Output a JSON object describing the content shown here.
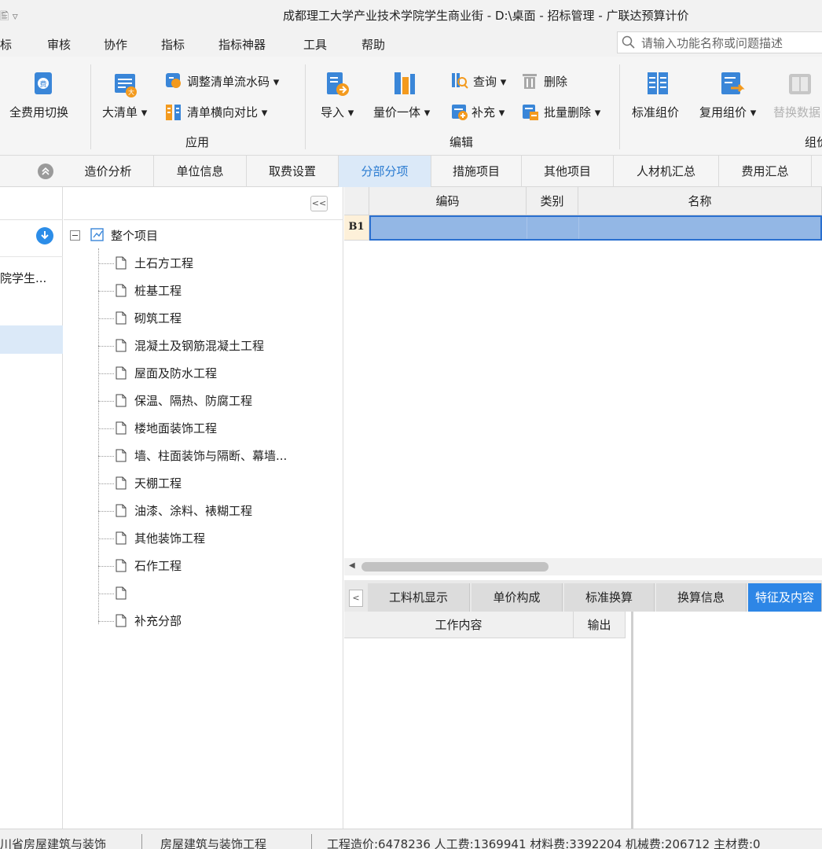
{
  "window": {
    "title": "成都理工大学产业技术学院学生商业街 - D:\\桌面 - 招标管理 - 广联达预算计价",
    "quick_access": "🖺 ▿"
  },
  "menu": {
    "items": [
      "标",
      "审核",
      "协作",
      "指标",
      "指标神器",
      "工具",
      "帮助"
    ],
    "search_placeholder": "请输入功能名称或问题描述"
  },
  "ribbon": {
    "full_fee_switch": "全费用切换",
    "big_list": "大清单",
    "adjust_serial": "调整清单流水码",
    "list_compare": "清单横向对比",
    "group_apply": "应用",
    "import": "导入",
    "price_unity": "量价一体",
    "query": "查询",
    "supplement": "补充",
    "delete": "删除",
    "batch_delete": "批量删除",
    "group_edit": "编辑",
    "std_price": "标准组价",
    "reuse_price": "复用组价",
    "replace_data": "替换数据",
    "group_price": "组价"
  },
  "tabs": [
    "造价分析",
    "单位信息",
    "取费设置",
    "分部分项",
    "措施项目",
    "其他项目",
    "人材机汇总",
    "费用汇总"
  ],
  "left_panel": {
    "project_name": "院学生..."
  },
  "tree": {
    "collapse_label": "<<",
    "root": "整个项目",
    "nodes": [
      "土石方工程",
      "桩基工程",
      "砌筑工程",
      "混凝土及钢筋混凝土工程",
      "屋面及防水工程",
      "保温、隔热、防腐工程",
      "楼地面装饰工程",
      "墙、柱面装饰与隔断、幕墙...",
      "天棚工程",
      "油漆、涂料、裱糊工程",
      "其他装饰工程",
      "石作工程",
      "",
      "补充分部"
    ]
  },
  "grid": {
    "columns": [
      "编码",
      "类别",
      "名称"
    ],
    "row_label": "B1"
  },
  "bottom": {
    "prev": "<",
    "tabs": [
      "工料机显示",
      "单价构成",
      "标准换算",
      "换算信息",
      "特征及内容"
    ],
    "columns": [
      "工作内容",
      "输出"
    ]
  },
  "status": {
    "seg1": "川省房屋建筑与装饰",
    "seg2": "房屋建筑与装饰工程",
    "seg3": "工程造价:6478236  人工费:1369941  材料费:3392204  机械费:206712  主材费:0"
  }
}
